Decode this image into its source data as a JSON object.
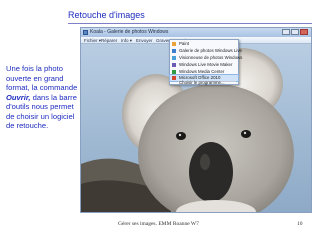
{
  "slide": {
    "title": "Retouche d'images",
    "body_parts": [
      "Une fois la photo ouverte en grand format, la commande ",
      "Ouvrir,",
      " dans la barre d'outils nous permet de choisir un logiciel de retouche."
    ],
    "footer": "Gérer ses images. EMM Roanne W7",
    "page_number": "10"
  },
  "screenshot": {
    "window_title": "Koala - Galerie de photos Windows",
    "menu": [
      "Fichier ▾",
      "Réparer",
      "Info ▾",
      "Envoyer",
      "Graver ▾",
      "Ouvrir ▾"
    ],
    "open_menu": {
      "items": [
        {
          "label": "Paint",
          "icon": "paint-icon",
          "color": "#e8a33a"
        },
        {
          "label": "Galerie de photos Windows Live",
          "icon": "photo-gallery-icon",
          "color": "#3b7fd0"
        },
        {
          "label": "Visionneuse de photos Windows",
          "icon": "photo-viewer-icon",
          "color": "#4aa0d8"
        },
        {
          "label": "Windows Live Movie Maker",
          "icon": "movie-maker-icon",
          "color": "#6c5bb3"
        },
        {
          "label": "Windows Media Center",
          "icon": "media-center-icon",
          "color": "#2f9a44"
        },
        {
          "label": "Microsoft Office 2010",
          "icon": "office-icon",
          "color": "#d2472e"
        }
      ],
      "choose_label": "Choisir le programme..."
    }
  }
}
